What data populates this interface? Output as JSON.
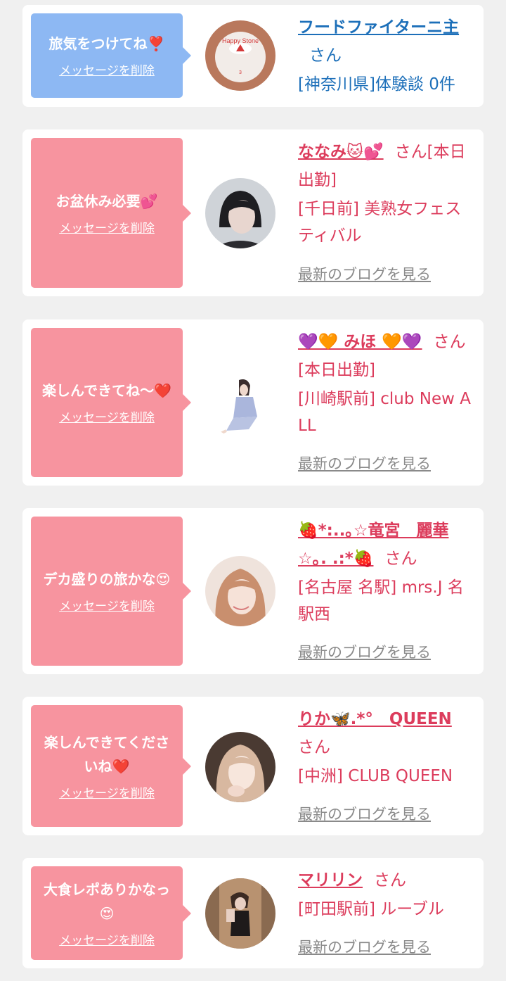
{
  "cards": [
    {
      "message": "旅気をつけてね❣️",
      "delete_label": "メッセージを削除",
      "name": "フードファイターニ主",
      "san": "さん",
      "detail": "[神奈川県]体験談 0件",
      "avatar_text": "Happy Stone"
    },
    {
      "message": "お盆休み必要💕",
      "delete_label": "メッセージを削除",
      "name": "ななみ🐱💕",
      "san": "さん[本日出勤]",
      "detail": "[千日前] 美熟女フェスティバル",
      "blog_label": "最新のブログを見る"
    },
    {
      "message": "楽しんできてね〜❤️",
      "delete_label": "メッセージを削除",
      "name": "💜🧡 みほ 🧡💜",
      "san": "さん[本日出勤]",
      "detail": "[川崎駅前] club New ALL",
      "blog_label": "最新のブログを見る"
    },
    {
      "message": "デカ盛りの旅かな😍",
      "delete_label": "メッセージを削除",
      "name": "🍓*:..｡☆竜宮　麗華☆｡. .:*🍓",
      "san": "さん",
      "detail": "[名古屋 名駅] mrs.J 名駅西",
      "blog_label": "最新のブログを見る"
    },
    {
      "message": "楽しんできてくださいね❤️",
      "delete_label": "メッセージを削除",
      "name": "りか🦋.*°　QUEEN",
      "san": "さん",
      "detail": "[中洲] CLUB QUEEN",
      "blog_label": "最新のブログを見る"
    },
    {
      "message": "大食レポありかなっ😍",
      "delete_label": "メッセージを削除",
      "name": "マリリン",
      "san": "さん",
      "detail": "[町田駅前] ルーブル",
      "blog_label": "最新のブログを見る"
    }
  ],
  "colors": {
    "blue_bubble": "#8db8f3",
    "pink_bubble": "#f7949f",
    "blue_name": "#1c6fb9",
    "pink_name": "#dc3c5c",
    "blog_link": "#8a8a8a"
  }
}
